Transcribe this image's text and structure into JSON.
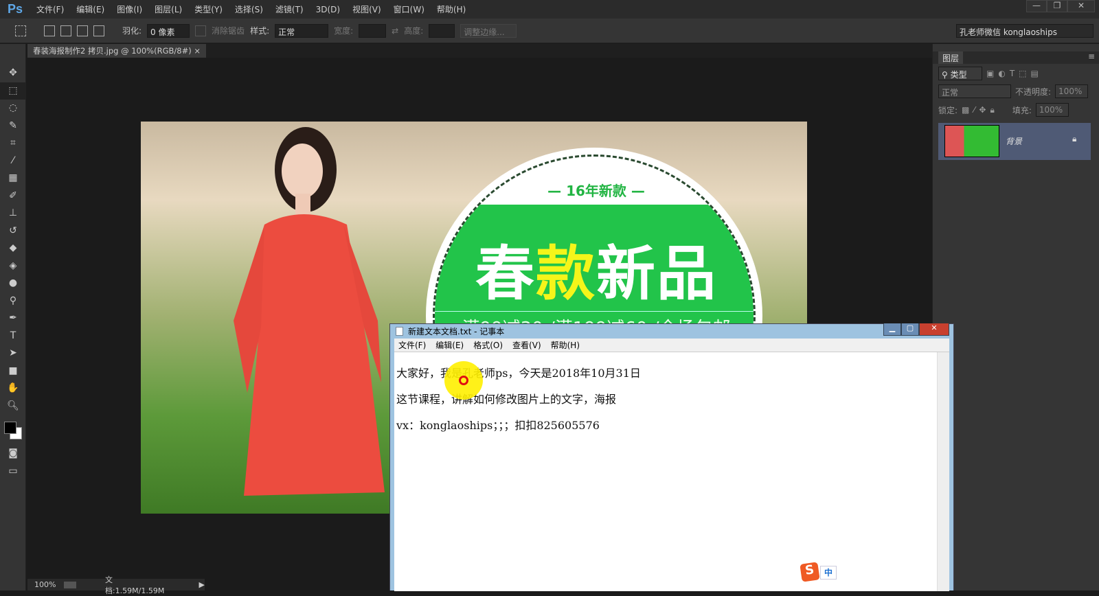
{
  "app": {
    "logo": "Ps",
    "menus": [
      "文件(F)",
      "编辑(E)",
      "图像(I)",
      "图层(L)",
      "类型(Y)",
      "选择(S)",
      "滤镜(T)",
      "3D(D)",
      "视图(V)",
      "窗口(W)",
      "帮助(H)"
    ],
    "window_buttons": [
      "—",
      "❐",
      "✕"
    ]
  },
  "options": {
    "feather_label": "羽化:",
    "feather_value": "0 像素",
    "antialias_label": "消除锯齿",
    "style_label": "样式:",
    "style_value": "正常",
    "width_label": "宽度:",
    "height_label": "高度:",
    "refine_button": "调整边缘...",
    "workspace": "孔老师微信 konglaoships"
  },
  "document": {
    "tab_title": "春装海报制作2 拷贝.jpg @ 100%(RGB/8#)",
    "close": "×",
    "zoom": "100%",
    "doc_info": "文档:1.59M/1.59M"
  },
  "poster": {
    "subtitle": "— 16年新款 —",
    "title_1": "春",
    "title_2": "款",
    "title_3": "新品",
    "promo": "满99减30 /满199减60 /全场包邮",
    "colors": {
      "green": "#22c44a",
      "yellow": "#f5f51a"
    }
  },
  "layers_panel": {
    "tab": "图层",
    "filter": "类型",
    "blend_mode": "正常",
    "opacity_label": "不透明度:",
    "opacity": "100%",
    "lock_label": "锁定:",
    "fill_label": "填充:",
    "fill": "100%",
    "layers": [
      {
        "name": "背景",
        "visible": true,
        "locked": true
      }
    ]
  },
  "notepad": {
    "title": "新建文本文档.txt - 记事本",
    "menus": [
      "文件(F)",
      "编辑(E)",
      "格式(O)",
      "查看(V)",
      "帮助(H)"
    ],
    "lines": [
      "大家好，我是孔老师ps，今天是2018年10月31日",
      "这节课程，讲解如何修改图片上的文字，海报",
      "vx：konglaoships；；；扣扣825605576"
    ],
    "buttons": [
      "▁",
      "▢",
      "✕"
    ]
  },
  "ime": {
    "logo": "S",
    "mode": "中"
  }
}
